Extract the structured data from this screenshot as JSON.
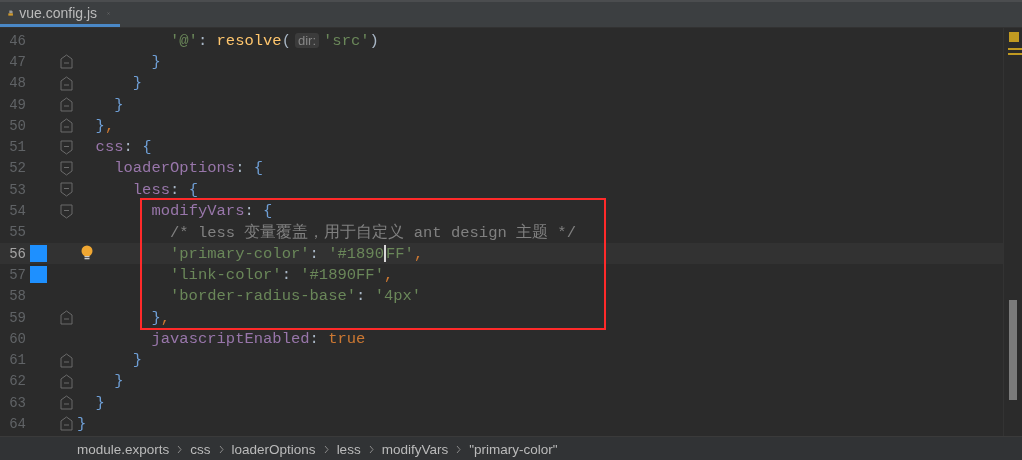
{
  "tab": {
    "title": "vue.config.js",
    "selected": true
  },
  "lines": [
    {
      "number": "46",
      "kind": "plain",
      "tokens": [
        {
          "kind": "str",
          "text": "          '@'"
        },
        {
          "kind": "punct",
          "text": ": "
        },
        {
          "kind": "fn",
          "text": "resolve"
        },
        {
          "kind": "punct",
          "text": "("
        },
        {
          "kind": "hint",
          "text": "dir:"
        },
        {
          "kind": "str",
          "text": "'src'"
        },
        {
          "kind": "punct",
          "text": ")"
        }
      ]
    },
    {
      "number": "47",
      "kind": "closer",
      "tokens": [
        {
          "kind": "brace",
          "text": "        }"
        }
      ]
    },
    {
      "number": "48",
      "kind": "closer",
      "tokens": [
        {
          "kind": "brace",
          "text": "      }"
        }
      ]
    },
    {
      "number": "49",
      "kind": "closer",
      "tokens": [
        {
          "kind": "brace",
          "text": "    }"
        }
      ]
    },
    {
      "number": "50",
      "kind": "closer",
      "tokens": [
        {
          "kind": "brace",
          "text": "  }"
        },
        {
          "kind": "kw",
          "text": ","
        }
      ]
    },
    {
      "number": "51",
      "kind": "opener",
      "tokens": [
        {
          "kind": "key",
          "text": "  css"
        },
        {
          "kind": "punct",
          "text": ": "
        },
        {
          "kind": "brace",
          "text": "{"
        }
      ]
    },
    {
      "number": "52",
      "kind": "opener",
      "tokens": [
        {
          "kind": "key",
          "text": "    loaderOptions"
        },
        {
          "kind": "punct",
          "text": ": "
        },
        {
          "kind": "brace",
          "text": "{"
        }
      ]
    },
    {
      "number": "53",
      "kind": "opener",
      "tokens": [
        {
          "kind": "key",
          "text": "      less"
        },
        {
          "kind": "punct",
          "text": ": "
        },
        {
          "kind": "brace",
          "text": "{"
        }
      ]
    },
    {
      "number": "54",
      "kind": "opener",
      "boxed": true,
      "tokens": [
        {
          "kind": "key",
          "text": "        modifyVars"
        },
        {
          "kind": "punct",
          "text": ": "
        },
        {
          "kind": "brace",
          "text": "{"
        }
      ]
    },
    {
      "number": "55",
      "kind": "plain",
      "boxed": true,
      "tokens": [
        {
          "kind": "comment",
          "text": "          /* less 变量覆盖，用于自定义 ant design 主题 */"
        }
      ]
    },
    {
      "number": "56",
      "kind": "plain",
      "boxed": true,
      "current": true,
      "changed": true,
      "bulb": true,
      "tokens": [
        {
          "kind": "str",
          "text": "          'primary-color'"
        },
        {
          "kind": "punct",
          "text": ": "
        },
        {
          "kind": "str",
          "text": "'#1890",
          "caret_after": true
        },
        {
          "kind": "str",
          "text": "FF'"
        },
        {
          "kind": "kw",
          "text": ","
        }
      ]
    },
    {
      "number": "57",
      "kind": "plain",
      "boxed": true,
      "changed": true,
      "tokens": [
        {
          "kind": "str",
          "text": "          'link-color'"
        },
        {
          "kind": "punct",
          "text": ": "
        },
        {
          "kind": "str",
          "text": "'#1890FF'"
        },
        {
          "kind": "kw",
          "text": ","
        }
      ]
    },
    {
      "number": "58",
      "kind": "plain",
      "boxed": true,
      "tokens": [
        {
          "kind": "str",
          "text": "          'border-radius-base'"
        },
        {
          "kind": "punct",
          "text": ": "
        },
        {
          "kind": "str",
          "text": "'4px'"
        }
      ]
    },
    {
      "number": "59",
      "kind": "closer",
      "boxed": true,
      "tokens": [
        {
          "kind": "brace",
          "text": "        }"
        },
        {
          "kind": "kw",
          "text": ","
        }
      ]
    },
    {
      "number": "60",
      "kind": "plain",
      "tokens": [
        {
          "kind": "key",
          "text": "        javascriptEnabled"
        },
        {
          "kind": "punct",
          "text": ": "
        },
        {
          "kind": "kw",
          "text": "true"
        }
      ]
    },
    {
      "number": "61",
      "kind": "closer",
      "tokens": [
        {
          "kind": "brace",
          "text": "      }"
        }
      ]
    },
    {
      "number": "62",
      "kind": "closer",
      "tokens": [
        {
          "kind": "brace",
          "text": "    }"
        }
      ]
    },
    {
      "number": "63",
      "kind": "closer",
      "tokens": [
        {
          "kind": "brace",
          "text": "  }"
        }
      ]
    },
    {
      "number": "64",
      "kind": "closer",
      "tokens": [
        {
          "kind": "brace",
          "text": "}"
        }
      ]
    }
  ],
  "breadcrumbs": [
    "module.exports",
    "css",
    "loaderOptions",
    "less",
    "modifyVars",
    "\"primary-color\""
  ]
}
